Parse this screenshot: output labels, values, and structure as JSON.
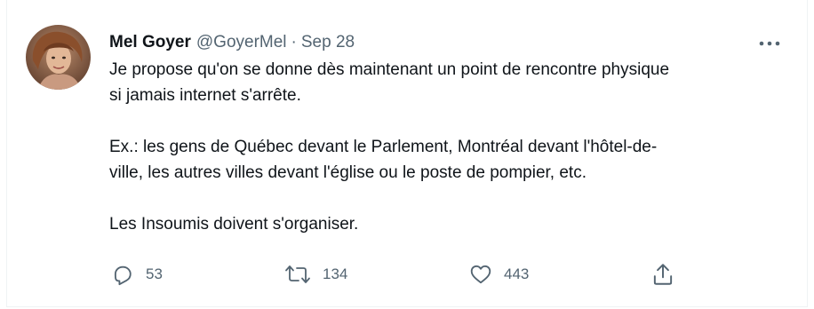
{
  "tweet": {
    "author_name": "Mel Goyer",
    "author_handle": "@GoyerMel",
    "separator": "·",
    "date": "Sep 28",
    "paragraphs": [
      {
        "lines": [
          "Je propose qu'on se donne dès maintenant un point de rencontre physique",
          "si jamais internet s'arrête."
        ]
      },
      {
        "lines": [
          "Ex.: les gens de Québec devant le Parlement, Montréal devant l'hôtel-de-",
          "ville, les autres villes devant l'église ou le poste de pompier, etc."
        ]
      },
      {
        "lines": [
          "Les Insoumis doivent s'organiser."
        ]
      }
    ],
    "actions": {
      "reply_count": "53",
      "retweet_count": "134",
      "like_count": "443"
    }
  },
  "icons": {
    "more": "more-horizontal-icon",
    "reply": "reply-icon",
    "retweet": "retweet-icon",
    "like": "heart-icon",
    "share": "share-icon"
  },
  "colors": {
    "text_primary": "#0f1419",
    "text_secondary": "#536471",
    "border": "#eff3f4"
  }
}
